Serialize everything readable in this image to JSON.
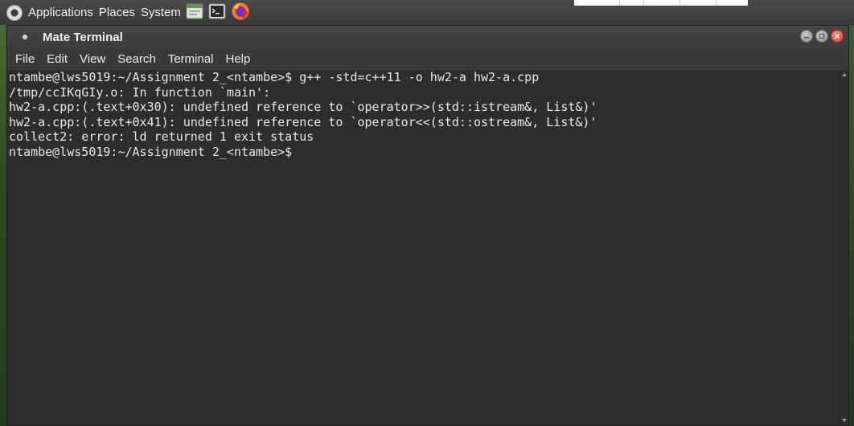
{
  "panel": {
    "menus": [
      "Applications",
      "Places",
      "System"
    ],
    "launcher_icons": [
      "file-manager-icon",
      "terminal-icon",
      "firefox-icon"
    ]
  },
  "window": {
    "title": "Mate Terminal",
    "menu": [
      "File",
      "Edit",
      "View",
      "Search",
      "Terminal",
      "Help"
    ]
  },
  "terminal": {
    "lines": [
      "ntambe@lws5019:~/Assignment 2_<ntambe>$ g++ -std=c++11 -o hw2-a hw2-a.cpp",
      "/tmp/ccIKqGIy.o: In function `main':",
      "hw2-a.cpp:(.text+0x30): undefined reference to `operator>>(std::istream&, List&)'",
      "hw2-a.cpp:(.text+0x41): undefined reference to `operator<<(std::ostream&, List&)'",
      "collect2: error: ld returned 1 exit status",
      "ntambe@lws5019:~/Assignment 2_<ntambe>$"
    ]
  },
  "colors": {
    "terminal_bg": "#2d2d2d",
    "terminal_fg": "#e8e8e8",
    "close_button": "#d64a34"
  }
}
